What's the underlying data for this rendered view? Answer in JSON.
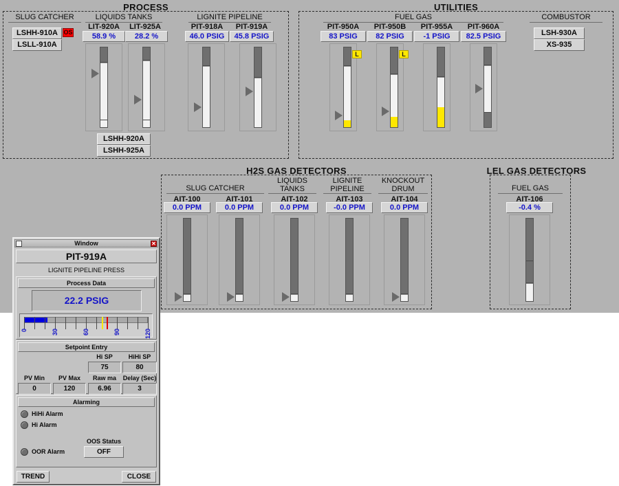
{
  "colors": {
    "backdrop": "#b3b3b3",
    "value_text": "#1414c8",
    "alarm_red": "#ff0000",
    "low_yellow": "#ffe800",
    "bar_empty": "#6f6f6f",
    "bar_fill": "#f2f2f2",
    "gauge_fill": "#0000e0"
  },
  "sections": {
    "process": {
      "title": "PROCESS"
    },
    "utilities": {
      "title": "UTILITIES"
    },
    "h2s": {
      "title": "H2S GAS DETECTORS"
    },
    "lel": {
      "title": "LEL GAS DETECTORS"
    }
  },
  "process": {
    "slug_catcher": {
      "label": "SLUG CATCHER",
      "buttons": [
        {
          "label": "LSHH-910A",
          "badge": "OS"
        },
        {
          "label": "LSLL-910A",
          "badge": null
        }
      ]
    },
    "liquids_tanks": {
      "label": "LIQUIDS TANKS",
      "gauges": [
        {
          "tag": "LIT-920A",
          "value": "58.9 %",
          "fill_pct": 81,
          "low_pct": 0,
          "pointer_pct": 58.9,
          "lflag": false
        },
        {
          "tag": "LIT-925A",
          "value": "28.2 %",
          "fill_pct": 84,
          "low_pct": 0,
          "pointer_pct": 28.2,
          "lflag": false
        }
      ],
      "buttons": [
        "LSHH-920A",
        "LSHH-925A"
      ]
    },
    "lignite_pipeline": {
      "label": "LIGNITE PIPELINE",
      "gauges": [
        {
          "tag": "PIT-918A",
          "value": "46.0 PSIG",
          "fill_pct": 77,
          "low_pct": 0,
          "pointer_pct": 18,
          "lflag": false
        },
        {
          "tag": "PIT-919A",
          "value": "45.8 PSIG",
          "fill_pct": 62,
          "low_pct": 0,
          "pointer_pct": 40,
          "lflag": false
        }
      ]
    }
  },
  "utilities": {
    "fuel_gas": {
      "label": "FUEL GAS",
      "gauges": [
        {
          "tag": "PIT-950A",
          "value": "83 PSIG",
          "fill_pct": 77,
          "low_pct": 9,
          "pointer_pct": 10,
          "lflag": true
        },
        {
          "tag": "PIT-950B",
          "value": "82 PSIG",
          "fill_pct": 66,
          "low_pct": 13,
          "pointer_pct": 14,
          "lflag": true
        },
        {
          "tag": "PIT-955A",
          "value": "-1 PSIG",
          "fill_pct": 63,
          "low_pct": 25,
          "pointer_pct": 0,
          "lflag": false
        },
        {
          "tag": "PIT-960A",
          "value": "82.5 PSIG",
          "fill_pct": 60,
          "low_pct": 0,
          "pointer_pct": 54,
          "lflag": false
        }
      ]
    },
    "combustor": {
      "label": "COMBUSTOR",
      "buttons": [
        "LSH-930A",
        "XS-935"
      ]
    }
  },
  "h2s_detectors": [
    {
      "group": "SLUG CATCHER",
      "tag": "AIT-100",
      "value": "0.0 PPM",
      "fill_pct": 8,
      "pointer_pct": 2
    },
    {
      "group": "",
      "tag": "AIT-101",
      "value": "0.0 PPM",
      "fill_pct": 8,
      "pointer_pct": 2
    },
    {
      "group": "LIQUIDS TANKS",
      "tag": "AIT-102",
      "value": "0.0 PPM",
      "fill_pct": 8,
      "pointer_pct": 2
    },
    {
      "group": "LIGNITE PIPELINE",
      "tag": "AIT-103",
      "value": "-0.0 PPM",
      "fill_pct": 8,
      "pointer_pct": 2
    },
    {
      "group": "KNOCKOUT DRUM",
      "tag": "AIT-104",
      "value": "0.0 PPM",
      "fill_pct": 8,
      "pointer_pct": 2
    }
  ],
  "lel_detectors": [
    {
      "group": "FUEL GAS",
      "tag": "AIT-106",
      "value": "-0.4 %",
      "fill_pct": 22,
      "pointer_pct": 0
    }
  ],
  "dialog": {
    "titlebar": {
      "title": "Window",
      "close_glyph": "✕"
    },
    "tag": "PIT-919A",
    "description": "LIGNITE PIPELINE PRESS",
    "process_data": {
      "header": "Process Data",
      "value": "22.2 PSIG",
      "gauge": {
        "min": 0,
        "max": 120,
        "value": 22.2,
        "ticks": [
          0,
          10,
          20,
          30,
          40,
          50,
          60,
          70,
          80,
          90,
          100,
          110,
          120
        ],
        "tick_labels": [
          "0",
          "30",
          "60",
          "90",
          "120"
        ],
        "hi_marker": 75,
        "hihi_marker": 80,
        "hi_color": "#ffe800",
        "hihi_color": "#e00000"
      }
    },
    "setpoint_entry": {
      "header": "Setpoint Entry",
      "fields": [
        {
          "label": "Hi SP",
          "value": "75"
        },
        {
          "label": "HiHi SP",
          "value": "80"
        },
        {
          "label": "PV Min",
          "value": "0"
        },
        {
          "label": "PV Max",
          "value": "120"
        },
        {
          "label": "Raw ma",
          "value": "6.96"
        },
        {
          "label": "Delay (Sec)",
          "value": "3"
        }
      ]
    },
    "alarming": {
      "header": "Alarming",
      "alarms": [
        {
          "label": "HiHi Alarm",
          "active": false
        },
        {
          "label": "Hi Alarm",
          "active": false
        },
        {
          "label": "OOR Alarm",
          "active": false
        }
      ],
      "oos": {
        "label": "OOS Status",
        "value": "OFF"
      }
    },
    "buttons": {
      "trend": "TREND",
      "close": "CLOSE"
    }
  }
}
